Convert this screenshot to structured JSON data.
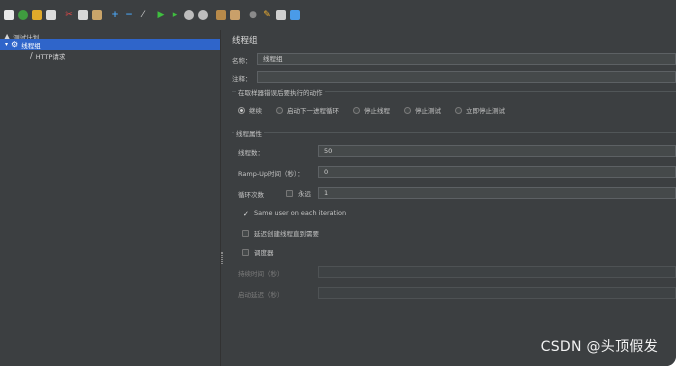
{
  "toolbar": {
    "icons": [
      "new-plan-icon",
      "templates-icon",
      "open-icon",
      "save-icon",
      "cut-icon",
      "copy-icon",
      "paste-icon",
      "add-icon",
      "remove-icon",
      "toggle-icon",
      "start-icon",
      "start-no-pauses-icon",
      "stop-icon",
      "shutdown-icon",
      "clear-icon",
      "clear-all-icon",
      "search-icon",
      "reset-search-icon",
      "function-helper-icon",
      "help-icon"
    ]
  },
  "tree": {
    "items": [
      {
        "label": "测试计划",
        "icon": "test-plan-icon"
      },
      {
        "label": "线程组",
        "icon": "thread-group-icon",
        "selected": true
      },
      {
        "label": "HTTP请求",
        "icon": "http-sampler-icon"
      }
    ]
  },
  "panel": {
    "title": "线程组",
    "name_label": "名称：",
    "name_value": "线程组",
    "comment_label": "注释：",
    "comment_value": "",
    "on_error_section": "在取样器错误后要执行的动作",
    "on_error_options": [
      "继续",
      "启动下一进程循环",
      "停止线程",
      "停止测试",
      "立即停止测试"
    ],
    "on_error_selected": 0,
    "thread_props_section": "线程属性",
    "threads_label": "线程数：",
    "threads_value": "50",
    "rampup_label": "Ramp-Up时间（秒）：",
    "rampup_value": "0",
    "loop_label": "循环次数",
    "loop_forever_label": "永远",
    "loop_forever_checked": false,
    "loop_value": "1",
    "same_user_label": "Same user on each iteration",
    "same_user_checked": true,
    "delay_label": "延迟创建线程直到需要",
    "delay_checked": false,
    "scheduler_label": "调度器",
    "scheduler_checked": false,
    "duration_label": "持续时间（秒）",
    "duration_value": "",
    "startup_delay_label": "启动延迟（秒）",
    "startup_delay_value": ""
  },
  "watermark": "CSDN @头顶假发",
  "colors": {
    "background": "#3c3f41",
    "selection": "#2f65ca",
    "field": "#45494a",
    "text": "#c8c8c8"
  }
}
